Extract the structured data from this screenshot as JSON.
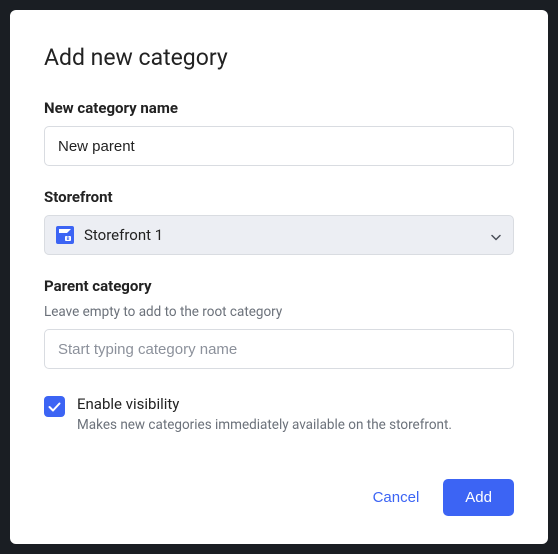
{
  "title": "Add new category",
  "name_field": {
    "label": "New category name",
    "value": "New parent"
  },
  "storefront_field": {
    "label": "Storefront",
    "value": "Storefront 1"
  },
  "parent_field": {
    "label": "Parent category",
    "hint": "Leave empty to add to the root category",
    "placeholder": "Start typing category name",
    "value": ""
  },
  "visibility": {
    "checked": true,
    "label": "Enable visibility",
    "hint": "Makes new categories immediately available on the storefront."
  },
  "actions": {
    "cancel": "Cancel",
    "submit": "Add"
  },
  "colors": {
    "primary": "#3c64f4"
  }
}
